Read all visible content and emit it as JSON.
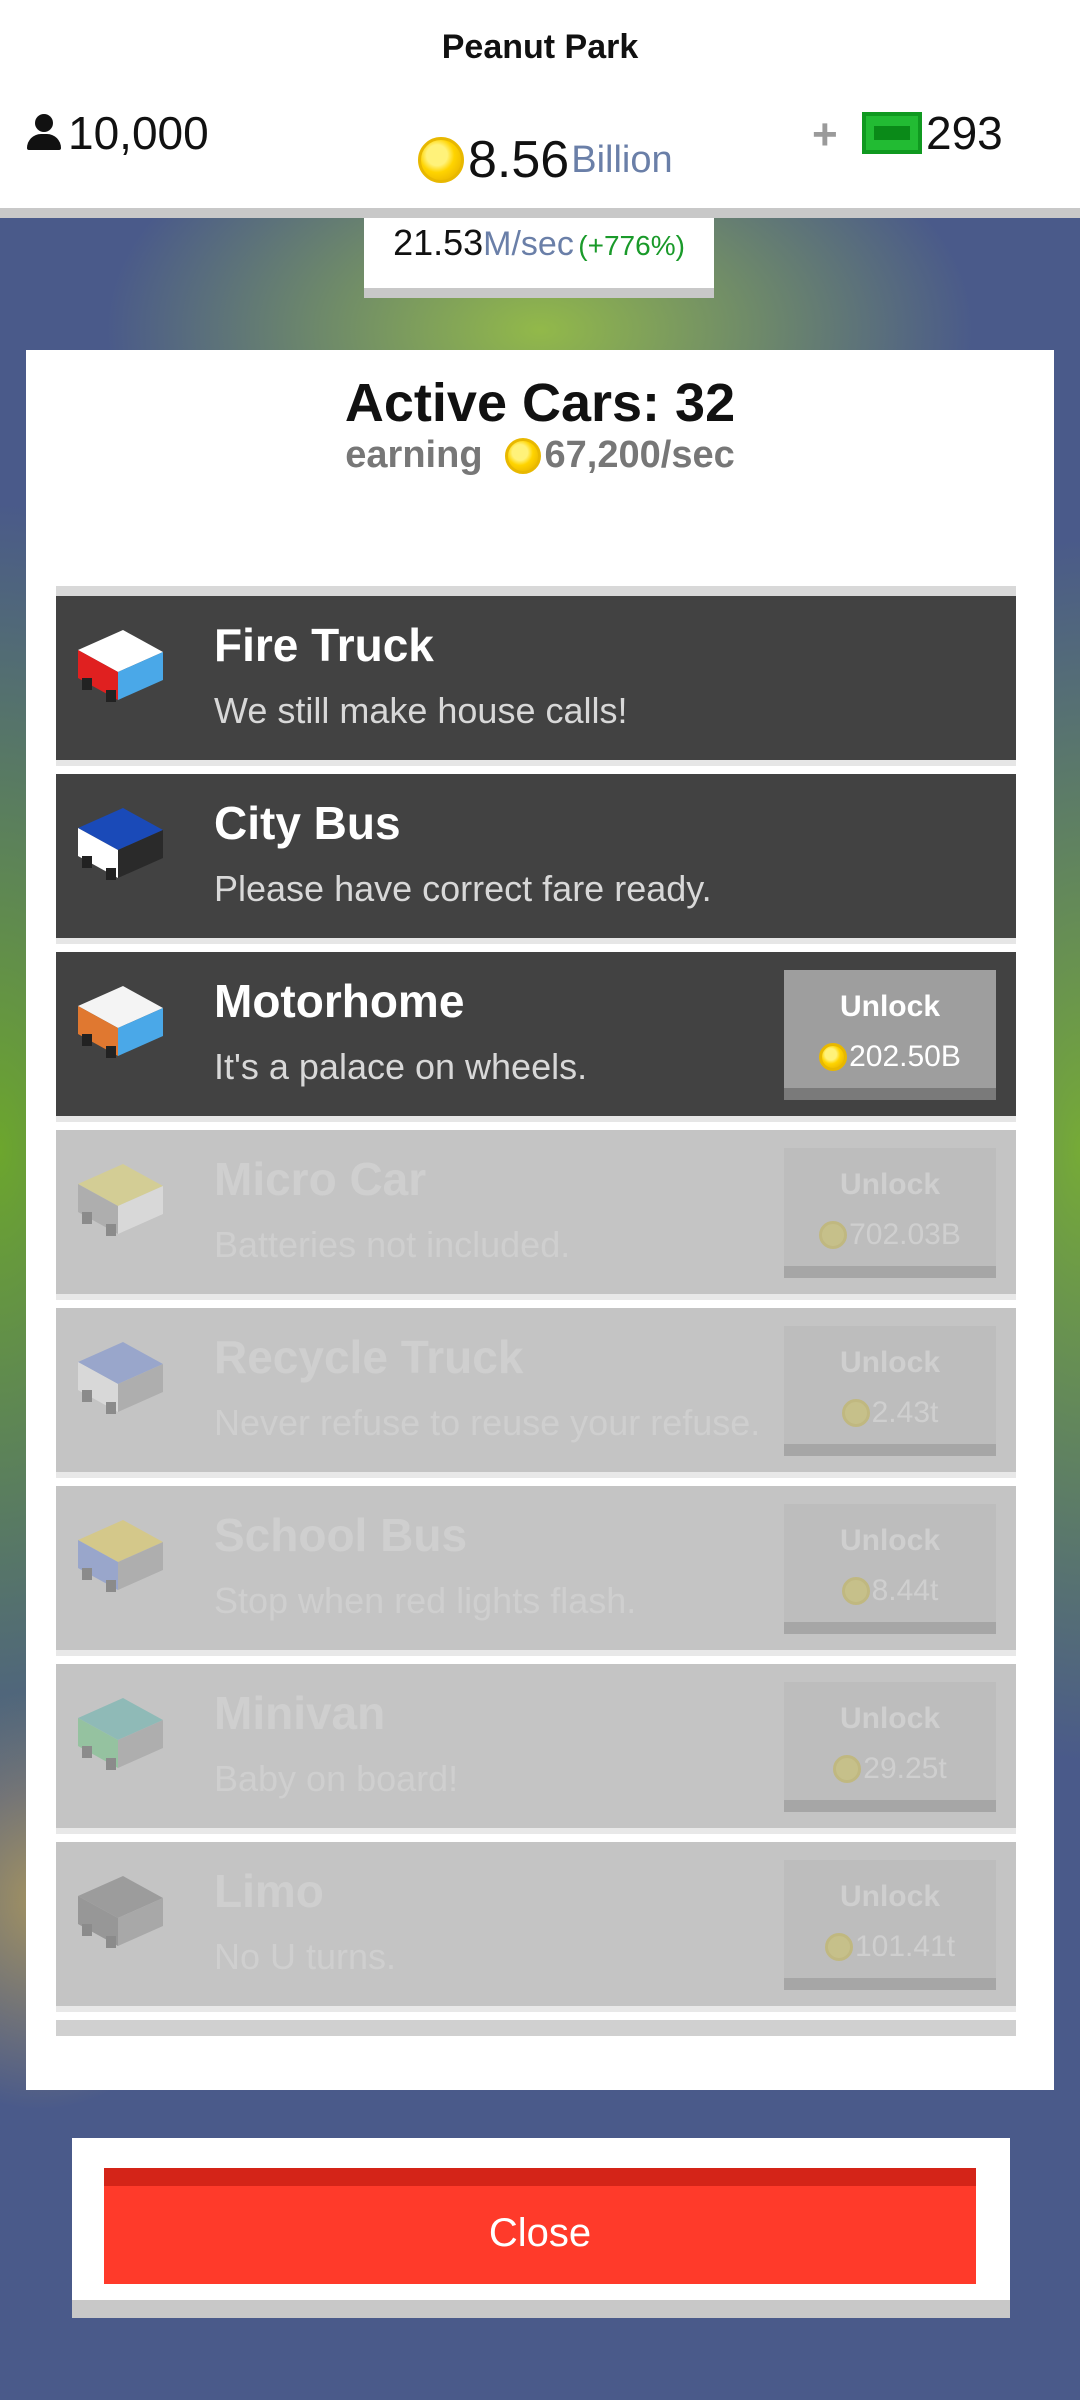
{
  "hud": {
    "park_name": "Peanut Park",
    "visitors": "10,000",
    "coins_amount": "8.56",
    "coins_unit": "Billion",
    "cash_plus": "+",
    "cash_amount": "293",
    "rate_value": "21.53",
    "rate_unit": "M/sec",
    "rate_pct": "(+776%)"
  },
  "panel": {
    "title": "Active Cars: 32",
    "earning_label": "earning",
    "earning_value": "67,200/sec"
  },
  "cars": [
    {
      "name": "Fire Truck",
      "desc": "We still make house calls!",
      "state": "owned",
      "colors": [
        "#ffffff",
        "#e02020",
        "#4aa8e8"
      ]
    },
    {
      "name": "City Bus",
      "desc": "Please have correct fare ready.",
      "state": "owned",
      "colors": [
        "#1a4ab8",
        "#ffffff",
        "#2a2a2a"
      ]
    },
    {
      "name": "Motorhome",
      "desc": "It's a palace on wheels.",
      "state": "unlockable",
      "unlock_label": "Unlock",
      "price": "202.50B",
      "colors": [
        "#f4f4f4",
        "#e07830",
        "#4aa8e8"
      ]
    },
    {
      "name": "Micro Car",
      "desc": "Batteries not included.",
      "state": "locked",
      "unlock_label": "Unlock",
      "price": "702.03B",
      "colors": [
        "#f0e040",
        "#888888",
        "#ffffff"
      ]
    },
    {
      "name": "Recycle Truck",
      "desc": "Never refuse to reuse your refuse.",
      "state": "locked",
      "unlock_label": "Unlock",
      "price": "2.43t",
      "colors": [
        "#4a70d8",
        "#ffffff",
        "#888888"
      ]
    },
    {
      "name": "School Bus",
      "desc": "Stop when red lights flash.",
      "state": "locked",
      "unlock_label": "Unlock",
      "price": "8.44t",
      "colors": [
        "#f4d020",
        "#4a70d8",
        "#888888"
      ]
    },
    {
      "name": "Minivan",
      "desc": "Baby on board!",
      "state": "locked",
      "unlock_label": "Unlock",
      "price": "29.25t",
      "colors": [
        "#30a8a0",
        "#40c060",
        "#888888"
      ]
    },
    {
      "name": "Limo",
      "desc": "No U turns.",
      "state": "locked",
      "unlock_label": "Unlock",
      "price": "101.41t",
      "colors": [
        "#555555",
        "#444444",
        "#777777"
      ]
    }
  ],
  "close_label": "Close"
}
